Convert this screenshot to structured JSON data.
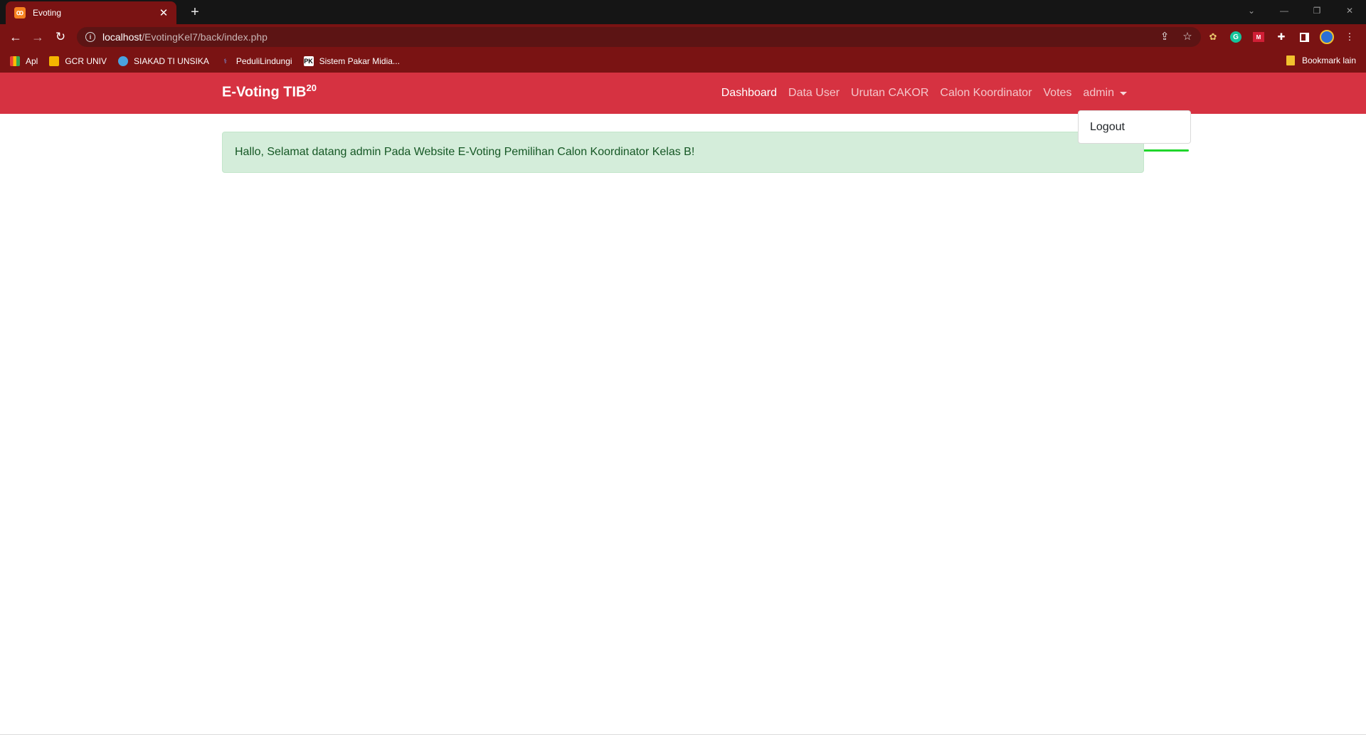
{
  "browser": {
    "tab": {
      "title": "Evoting",
      "favicon": "xampp-icon"
    },
    "url": {
      "host": "localhost",
      "path": "/EvotingKel7/back/index.php"
    },
    "bookmarks": [
      {
        "label": "Apl",
        "icon": "apps-grid-icon"
      },
      {
        "label": "GCR UNIV",
        "icon": "classroom-icon"
      },
      {
        "label": "SIAKAD TI UNSIKA",
        "icon": "siakad-icon"
      },
      {
        "label": "PeduliLindungi",
        "icon": "pedulilindungi-icon"
      },
      {
        "label": "Sistem Pakar Midia...",
        "icon": "pakar-icon"
      }
    ],
    "other_bookmarks": "Bookmark lain"
  },
  "navbar": {
    "brand": "E-Voting TIB",
    "brand_sup": "20",
    "links": [
      {
        "label": "Dashboard",
        "active": true
      },
      {
        "label": "Data User",
        "active": false
      },
      {
        "label": "Urutan CAKOR",
        "active": false
      },
      {
        "label": "Calon Koordinator",
        "active": false
      },
      {
        "label": "Votes",
        "active": false
      }
    ],
    "user_menu": "admin",
    "dropdown": {
      "items": [
        "Logout"
      ]
    }
  },
  "alert": {
    "text": "Hallo, Selamat datang admin Pada Website E-Voting Pemilihan Calon Koordinator Kelas B!"
  },
  "colors": {
    "navbar": "#d63241",
    "browser_frame": "#7a1313",
    "alert_bg": "#d4edda",
    "alert_text": "#155724",
    "highlight_line": "#1fd62b"
  }
}
